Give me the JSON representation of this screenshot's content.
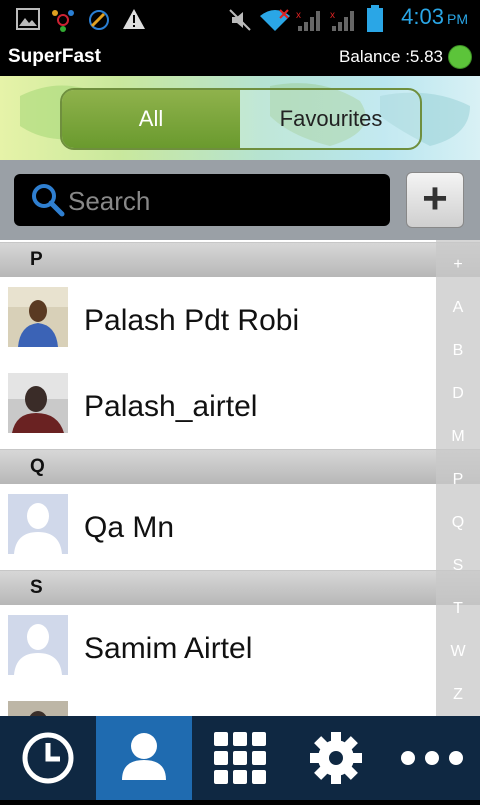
{
  "status_bar": {
    "time": "4:03",
    "ampm": "PM"
  },
  "app": {
    "title": "SuperFast",
    "balance": "Balance :5.83"
  },
  "tabs": {
    "all": "All",
    "favourites": "Favourites"
  },
  "search": {
    "placeholder": "Search",
    "add_label": "+"
  },
  "sections": [
    {
      "letter": "P",
      "contacts": [
        "Palash Pdt Robi",
        "Palash_airtel"
      ]
    },
    {
      "letter": "Q",
      "contacts": [
        "Qa Mn"
      ]
    },
    {
      "letter": "S",
      "contacts": [
        "Samim Airtel"
      ]
    }
  ],
  "index_letters": [
    "+",
    "A",
    "B",
    "D",
    "M",
    "P",
    "Q",
    "S",
    "T",
    "W",
    "Z"
  ],
  "bottom_nav": [
    "clock-icon",
    "contacts-icon",
    "dialpad-icon",
    "settings-icon",
    "more-icon"
  ],
  "colors": {
    "time": "#2aa6e6",
    "active_tab": "#1f6bb0",
    "balance_dot": "#5cc43a"
  }
}
